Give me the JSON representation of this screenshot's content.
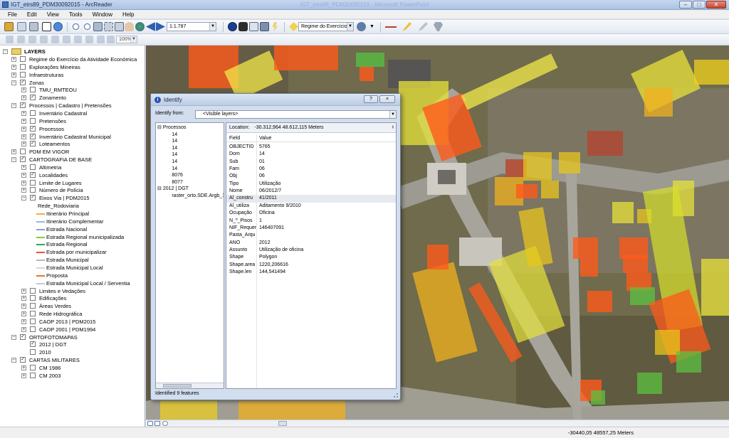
{
  "window": {
    "title": "IGT_etrs89_PDM30092015 - ArcReader",
    "ghost_title": "IGT_etrs89_PDM30092015 - Microsoft PowerPoint",
    "buttons": {
      "minimize": "–",
      "maximize": "□",
      "close": "✕"
    }
  },
  "menu": [
    "File",
    "Edit",
    "View",
    "Tools",
    "Window",
    "Help"
  ],
  "toolbar": {
    "scale": "1:1.787",
    "layer_combo": "Regime do Exercício",
    "zoom": "100%"
  },
  "toc": {
    "root": "LAYERS",
    "items": [
      {
        "label": "Regime do Exercício da Atividade Económica",
        "level": 1,
        "expander": "+",
        "checked": false
      },
      {
        "label": "Explorações Mineiras",
        "level": 1,
        "expander": "+",
        "checked": false
      },
      {
        "label": "Infraestruturas",
        "level": 1,
        "expander": "+",
        "checked": false
      },
      {
        "label": "Zonas",
        "level": 1,
        "expander": "−",
        "checked": true
      },
      {
        "label": "TMU_RMTEOU",
        "level": 2,
        "expander": "+",
        "checked": false
      },
      {
        "label": "Zonamento",
        "level": 2,
        "expander": "+",
        "checked": true
      },
      {
        "label": "Processos | Cadastro | Pretensões",
        "level": 1,
        "expander": "−",
        "checked": true
      },
      {
        "label": "Inventário Cadastral",
        "level": 2,
        "expander": "+",
        "checked": false
      },
      {
        "label": "Pretensões",
        "level": 2,
        "expander": "+",
        "checked": false
      },
      {
        "label": "Processos",
        "level": 2,
        "expander": "+",
        "checked": true
      },
      {
        "label": "Inventário Cadastral Municipal",
        "level": 2,
        "expander": "+",
        "checked": true
      },
      {
        "label": "Loteamentos",
        "level": 2,
        "expander": "+",
        "checked": true
      },
      {
        "label": "PDM EM VIGOR",
        "level": 1,
        "expander": "+",
        "checked": false
      },
      {
        "label": "CARTOGRAFIA DE BASE",
        "level": 1,
        "expander": "−",
        "checked": true
      },
      {
        "label": "Altimetria",
        "level": 2,
        "expander": "+",
        "checked": false
      },
      {
        "label": "Localidades",
        "level": 2,
        "expander": "+",
        "checked": true
      },
      {
        "label": "Limite de Lugares",
        "level": 2,
        "expander": "+",
        "checked": false
      },
      {
        "label": "Número de Polícia",
        "level": 2,
        "expander": "+",
        "checked": false
      },
      {
        "label": "Eixos Via | PDM2015",
        "level": 2,
        "expander": "−",
        "checked": true
      },
      {
        "label": "Rede_Rodoviaria",
        "level": 3,
        "symbol": "none"
      },
      {
        "label": "Itinerário Principal",
        "level": 3,
        "symbol": "#e8b24a"
      },
      {
        "label": "Itinerário Complementar",
        "level": 3,
        "symbol": "#9fb6d8"
      },
      {
        "label": "Estrada Nacional",
        "level": 3,
        "symbol": "#8aa0c0"
      },
      {
        "label": "Estrada Regional municipalizada",
        "level": 3,
        "symbol": "#8cc63e"
      },
      {
        "label": "Estrada Regional",
        "level": 3,
        "symbol": "#2fa84f"
      },
      {
        "label": "Estrada por municipalizar",
        "level": 3,
        "symbol": "#e5533d"
      },
      {
        "label": "Estrada Municipal",
        "level": 3,
        "symbol": "#b7b7b7"
      },
      {
        "label": "Estrada Municipal Local",
        "level": 3,
        "symbol": "#d6d6d6"
      },
      {
        "label": "Proposta",
        "level": 3,
        "symbol": "#e07a2e"
      },
      {
        "label": "Estrada Municipal Local / Serventia",
        "level": 3,
        "symbol": "#c9c9c9"
      },
      {
        "label": "Limites e Vedações",
        "level": 2,
        "expander": "+",
        "checked": false
      },
      {
        "label": "Edificações",
        "level": 2,
        "expander": "+",
        "checked": false
      },
      {
        "label": "Áreas Verdes",
        "level": 2,
        "expander": "+",
        "checked": false
      },
      {
        "label": "Rede Hidrográfica",
        "level": 2,
        "expander": "+",
        "checked": false
      },
      {
        "label": "CAOP 2013 | PDM2015",
        "level": 2,
        "expander": "+",
        "checked": false
      },
      {
        "label": "CAOP 2001 | PDM1994",
        "level": 2,
        "expander": "+",
        "checked": false
      },
      {
        "label": "ORTOFOTOMAPAS",
        "level": 1,
        "expander": "−",
        "checked": true
      },
      {
        "label": "2012 | DGT",
        "level": 2,
        "expander": "",
        "checked": true
      },
      {
        "label": "2010",
        "level": 2,
        "expander": "",
        "checked": false
      },
      {
        "label": "CARTAS MILITARES",
        "level": 1,
        "expander": "−",
        "checked": true
      },
      {
        "label": "CM 1986",
        "level": 2,
        "expander": "+",
        "checked": false
      },
      {
        "label": "CM 2003",
        "level": 2,
        "expander": "+",
        "checked": false
      }
    ]
  },
  "identify": {
    "title": "Identify",
    "help_btn": "?",
    "close_btn": "×",
    "from_label": "Identify from:",
    "from_value": "<Visible layers>",
    "tree": [
      {
        "label": "Processos",
        "indent": 0
      },
      {
        "label": "14",
        "indent": 1
      },
      {
        "label": "14",
        "indent": 1
      },
      {
        "label": "14",
        "indent": 1
      },
      {
        "label": "14",
        "indent": 1
      },
      {
        "label": "14",
        "indent": 1
      },
      {
        "label": "14",
        "indent": 1
      },
      {
        "label": "8076",
        "indent": 1
      },
      {
        "label": "8077",
        "indent": 1
      },
      {
        "label": "2012 | DGT",
        "indent": 0
      },
      {
        "label": "raster_orto.SDE.Argb_1",
        "indent": 1
      }
    ],
    "location_label": "Location:",
    "location_value": "-30.312,964  48.612,115 Meters",
    "columns": [
      "Field",
      "Value"
    ],
    "fields": [
      {
        "field": "OBJECTID",
        "value": "5765"
      },
      {
        "field": "Dom",
        "value": "14"
      },
      {
        "field": "Sub",
        "value": "01"
      },
      {
        "field": "Fam",
        "value": "06"
      },
      {
        "field": "Obj",
        "value": "06"
      },
      {
        "field": "Tipo",
        "value": "Utilização"
      },
      {
        "field": "Nome",
        "value": "06/2012/7"
      },
      {
        "field": "Al_constru",
        "value": "41/2011"
      },
      {
        "field": "Al_utiliza",
        "value": "Aditamento 9/2010"
      },
      {
        "field": "Ocupação",
        "value": "Oficina"
      },
      {
        "field": "N_º_Pisos",
        "value": "1"
      },
      {
        "field": "NIF_Requer",
        "value": "146407091"
      },
      {
        "field": "Pasta_Arqu",
        "value": ""
      },
      {
        "field": "ANO",
        "value": "2012"
      },
      {
        "field": "Assunto",
        "value": "Utilização de oficina"
      },
      {
        "field": "Shape",
        "value": "Polygon"
      },
      {
        "field": "Shape.area",
        "value": "1220,206616"
      },
      {
        "field": "Shape.len",
        "value": "144,541494"
      }
    ],
    "status": "Identified 9 features"
  },
  "status": {
    "coords": "-30440,05  48557,25 Meters"
  }
}
